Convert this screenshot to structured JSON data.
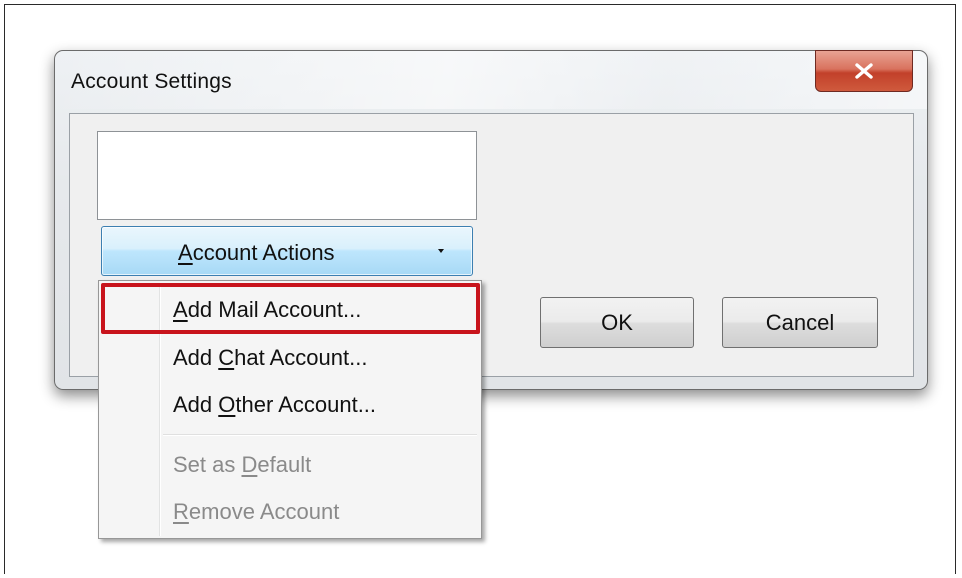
{
  "window": {
    "title": "Account Settings",
    "close_glyph": "x"
  },
  "account_actions": {
    "label_accel": "A",
    "label_rest": "ccount Actions",
    "icon": "chevron-down-icon"
  },
  "buttons": {
    "ok": "OK",
    "cancel": "Cancel"
  },
  "menu": {
    "items": [
      {
        "pre": "",
        "accel": "A",
        "post": "dd Mail Account...",
        "enabled": true
      },
      {
        "pre": "Add ",
        "accel": "C",
        "post": "hat Account...",
        "enabled": true
      },
      {
        "pre": "Add ",
        "accel": "O",
        "post": "ther Account...",
        "enabled": true
      },
      {
        "pre": "Set as ",
        "accel": "D",
        "post": "efault",
        "enabled": false
      },
      {
        "pre": "",
        "accel": "R",
        "post": "emove Account",
        "enabled": false
      }
    ]
  },
  "colors": {
    "highlight": "#c8141c",
    "close_button": "#c2402a",
    "accent_button": "#a7d9f5"
  }
}
